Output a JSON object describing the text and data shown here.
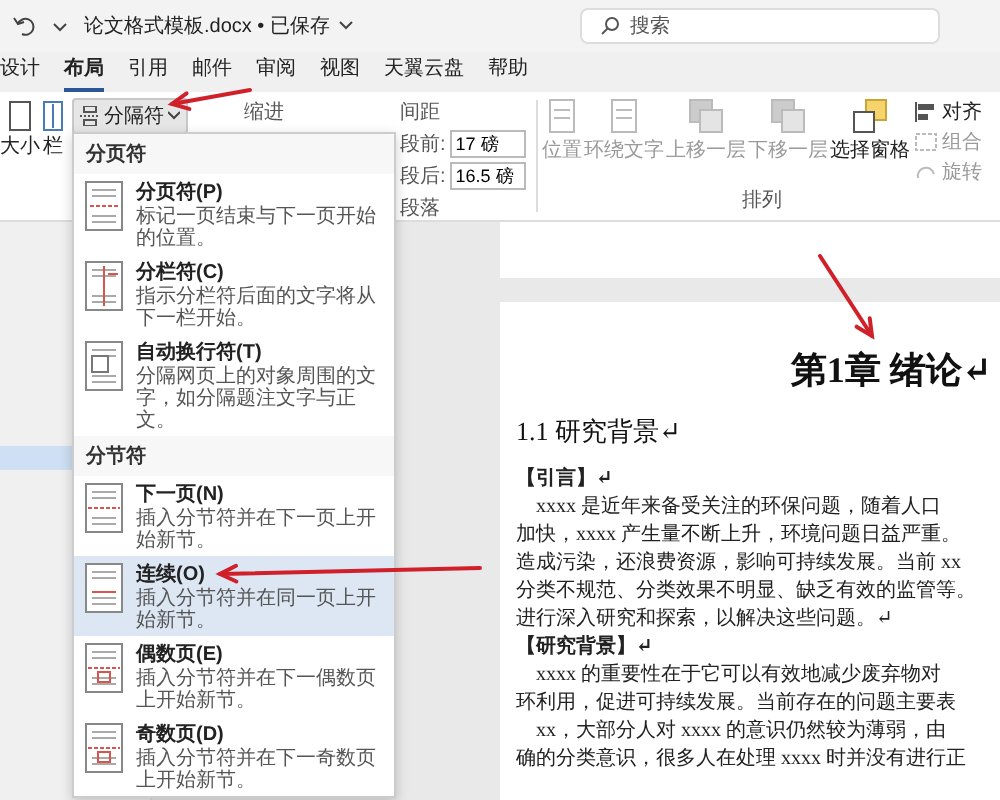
{
  "title_bar": {
    "title": "论文格式模板.docx • 已保存"
  },
  "search": {
    "placeholder": "搜索"
  },
  "tabs": [
    {
      "label": "设计",
      "selected": false
    },
    {
      "label": "布局",
      "selected": true
    },
    {
      "label": "引用",
      "selected": false
    },
    {
      "label": "邮件",
      "selected": false
    },
    {
      "label": "审阅",
      "selected": false
    },
    {
      "label": "视图",
      "selected": false
    },
    {
      "label": "天翼云盘",
      "selected": false
    },
    {
      "label": "帮助",
      "selected": false
    }
  ],
  "ribbon": {
    "page_setup": [
      {
        "label": "大小",
        "kind": "size"
      },
      {
        "label": "栏",
        "kind": "columns"
      }
    ],
    "breaks_button": "分隔符",
    "indent_label": "缩进",
    "spacing_label": "间距",
    "spacing": [
      {
        "label": "段前:",
        "value": "17 磅"
      },
      {
        "label": "段后:",
        "value": "16.5 磅"
      }
    ],
    "paragraph_group": "段落",
    "arrange": [
      {
        "label": "位置",
        "kind": "position",
        "disabled": true
      },
      {
        "label": "环绕文字",
        "kind": "wrap",
        "disabled": true
      },
      {
        "label": "上移一层",
        "kind": "forward",
        "disabled": true
      },
      {
        "label": "下移一层",
        "kind": "backward",
        "disabled": true
      },
      {
        "label": "选择窗格",
        "kind": "pane",
        "disabled": false
      }
    ],
    "arrange_small": [
      {
        "label": "对齐",
        "kind": "align",
        "disabled": false
      },
      {
        "label": "组合",
        "kind": "group",
        "disabled": true
      },
      {
        "label": "旋转",
        "kind": "rotate",
        "disabled": true
      }
    ],
    "arrange_group": "排列"
  },
  "menu": {
    "sections": [
      {
        "header": "分页符",
        "items": [
          {
            "title": "分页符(P)",
            "desc": "标记一页结束与下一页开始的位置。",
            "kind": "page",
            "selected": false
          },
          {
            "title": "分栏符(C)",
            "desc": "指示分栏符后面的文字将从下一栏开始。",
            "kind": "column",
            "selected": false
          },
          {
            "title": "自动换行符(T)",
            "desc": "分隔网页上的对象周围的文字，如分隔题注文字与正文。",
            "kind": "wrap",
            "selected": false
          }
        ]
      },
      {
        "header": "分节符",
        "items": [
          {
            "title": "下一页(N)",
            "desc": "插入分节符并在下一页上开始新节。",
            "kind": "next",
            "selected": false
          },
          {
            "title": "连续(O)",
            "desc": "插入分节符并在同一页上开始新节。",
            "kind": "continuous",
            "selected": true
          },
          {
            "title": "偶数页(E)",
            "desc": "插入分节符并在下一偶数页上开始新节。",
            "kind": "even",
            "selected": false
          },
          {
            "title": "奇数页(D)",
            "desc": "插入分节符并在下一奇数页上开始新节。",
            "kind": "odd",
            "selected": false
          }
        ]
      }
    ]
  },
  "document": {
    "heading": "第1章 绪论↵",
    "subheading": "1.1 研究背景↵",
    "lines": [
      {
        "kind": "label",
        "text": "【引言】↵"
      },
      {
        "kind": "indent",
        "text": "xxxx 是近年来备受关注的环保问题，随着人口"
      },
      {
        "kind": "plain",
        "text": "加快，xxxx 产生量不断上升，环境问题日益严重。"
      },
      {
        "kind": "plain",
        "text": "造成污染，还浪费资源，影响可持续发展。当前 xx"
      },
      {
        "kind": "plain",
        "text": "分类不规范、分类效果不明显、缺乏有效的监管等。"
      },
      {
        "kind": "plain",
        "text": "进行深入研究和探索，以解决这些问题。↵"
      },
      {
        "kind": "label",
        "text": "【研究背景】↵"
      },
      {
        "kind": "indent",
        "text": "xxxx 的重要性在于它可以有效地减少废弃物对"
      },
      {
        "kind": "plain",
        "text": "环利用，促进可持续发展。当前存在的问题主要表"
      },
      {
        "kind": "indent",
        "text": "xx，大部分人对 xxxx 的意识仍然较为薄弱，由"
      },
      {
        "kind": "plain",
        "text": "确的分类意识，很多人在处理 xxxx 时并没有进行正"
      }
    ]
  }
}
